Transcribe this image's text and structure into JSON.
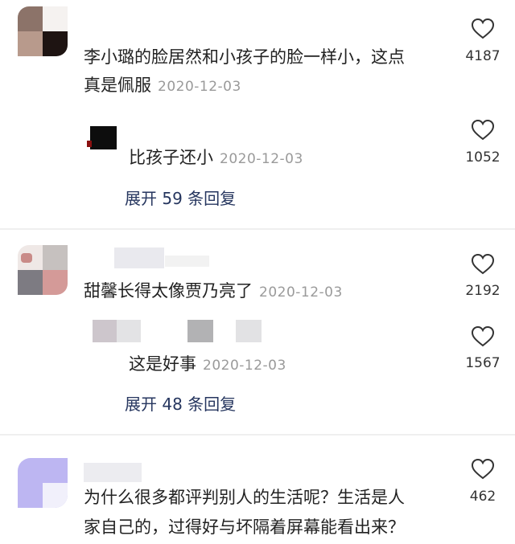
{
  "comments": [
    {
      "text_line1": "李小璐的脸居然和小孩子的脸一样小，这点",
      "text_line2": "真是佩服",
      "date": "2020-12-03",
      "likes": "4187",
      "reply": {
        "text": "比孩子还小",
        "date": "2020-12-03",
        "likes": "1052"
      },
      "expand": "展开 59 条回复"
    },
    {
      "text_line1": "甜馨长得太像贾乃亮了",
      "date": "2020-12-03",
      "likes": "2192",
      "reply": {
        "text": "这是好事",
        "date": "2020-12-03",
        "likes": "1567"
      },
      "expand": "展开 48 条回复"
    },
    {
      "text_line1": "为什么很多都评判别人的生活呢？生活是人",
      "text_line2": "家自己的，过得好与坏隔着屏幕能看出来？",
      "likes": "462"
    }
  ],
  "icons": {
    "like": "heart-outline-icon"
  },
  "colors": {
    "expand_link": "#26365f",
    "date": "#9a9a9a"
  }
}
